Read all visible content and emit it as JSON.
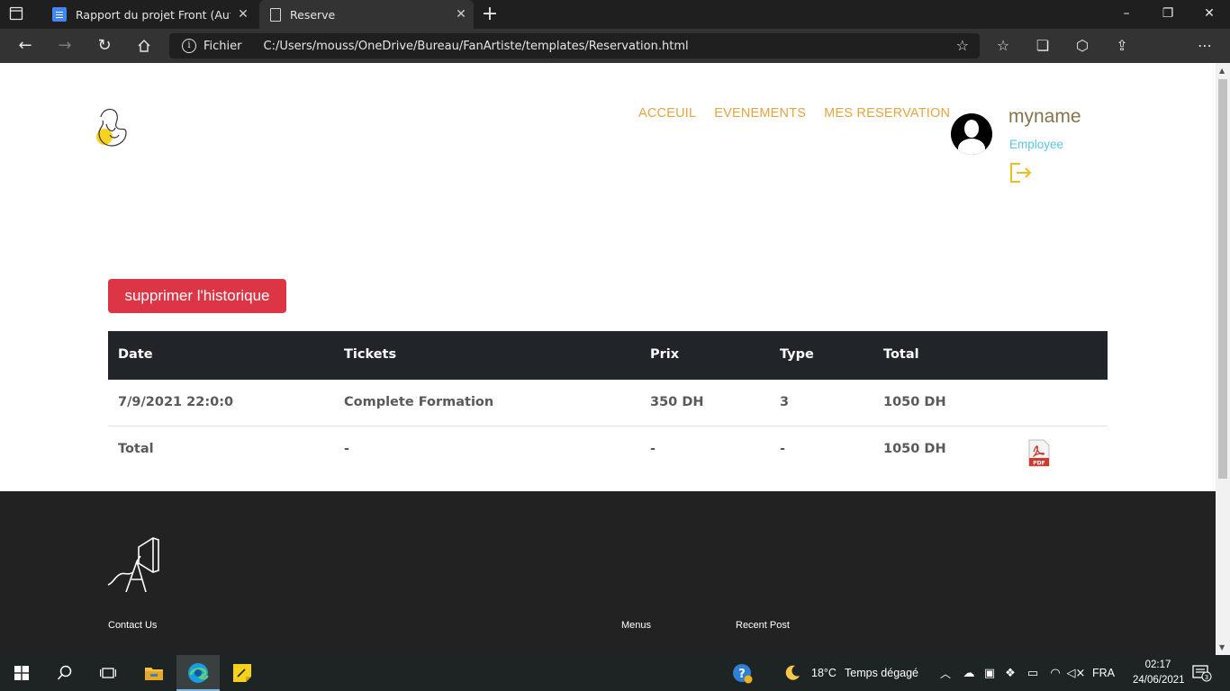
{
  "browser": {
    "tabs": [
      {
        "title": "Rapport du projet Front (AutoRe"
      },
      {
        "title": "Reserve"
      }
    ],
    "address": {
      "scheme": "Fichier",
      "url": "C:/Users/mouss/OneDrive/Bureau/FanArtiste/templates/Reservation.html"
    }
  },
  "header": {
    "nav": [
      "ACCEUIL",
      "EVENEMENTS",
      "MES RESERVATION"
    ],
    "user": {
      "name": "myname",
      "role": "Employee"
    }
  },
  "main": {
    "delete_history_label": "supprimer l'historique",
    "table": {
      "columns": [
        "Date",
        "Tickets",
        "Prix",
        "Type",
        "Total"
      ],
      "rows": [
        [
          "7/9/2021 22:0:0",
          "Complete Formation",
          "350 DH",
          "3",
          "1050 DH"
        ]
      ],
      "total_row": [
        "Total",
        "-",
        "-",
        "-",
        "1050 DH"
      ],
      "pdf_label": "PDF"
    }
  },
  "footer": {
    "contact_heading": "Contact Us",
    "menus_heading": "Menus",
    "recent_heading": "Recent Post"
  },
  "taskbar": {
    "weather": {
      "temp": "18°C",
      "desc": "Temps dégagé"
    },
    "lang": "FRA",
    "time": "02:17",
    "date": "24/06/2021",
    "notifications": "3"
  },
  "colors": {
    "nav_link": "#e5a542",
    "user_name": "#86734a",
    "user_role": "#5bc5e2",
    "danger": "#dc3545",
    "table_head": "#212529",
    "footer_bg": "#222222"
  }
}
